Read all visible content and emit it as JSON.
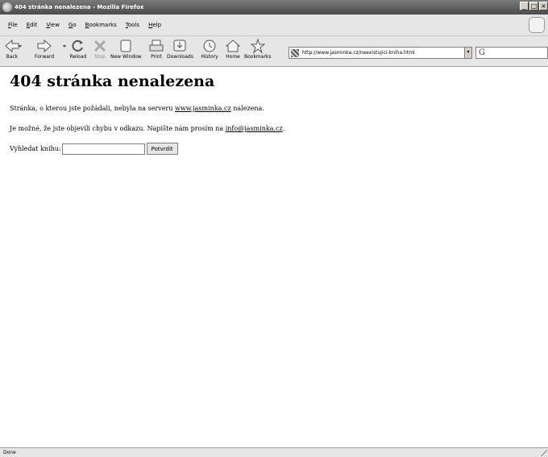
{
  "window": {
    "title": "404 stránka nenalezena - Mozilla Firefox",
    "controls": [
      "_",
      "□",
      "×"
    ]
  },
  "menu": [
    {
      "label": "File",
      "u": "F",
      "rest": "ile"
    },
    {
      "label": "Edit",
      "u": "E",
      "rest": "dit"
    },
    {
      "label": "View",
      "u": "V",
      "rest": "iew"
    },
    {
      "label": "Go",
      "u": "G",
      "rest": "o"
    },
    {
      "label": "Bookmarks",
      "u": "B",
      "rest": "ookmarks"
    },
    {
      "label": "Tools",
      "u": "T",
      "rest": "ools"
    },
    {
      "label": "Help",
      "u": "H",
      "rest": "elp"
    }
  ],
  "toolbar": {
    "back": "Back",
    "forward": "Forward",
    "reload": "Reload",
    "stop": "Stop",
    "new_window": "New Window",
    "print": "Print",
    "downloads": "Downloads",
    "history": "History",
    "home": "Home",
    "bookmarks": "Bookmarks",
    "url": "http://www.jasminka.cz/neexistujici-kniha.html",
    "url_dropdown": "▾",
    "search_engine_glyph": "G"
  },
  "page": {
    "heading": "404 stránka nenalezena",
    "p1_before": "Stránka, o kterou jste požádali, nebyla na serveru ",
    "p1_link": "www.jasminka.cz",
    "p1_after": " nalezena.",
    "p2_before": "Je možné, že jste objevili chybu v odkazu. Napište nám prosím na ",
    "p2_link": "info@jasminka.cz",
    "p2_after": ".",
    "search_label": "Vyhledat knihu:",
    "search_value": "",
    "submit_label": "Potvrdit"
  },
  "status": {
    "text": "Done"
  },
  "colors": {
    "chrome": "#e6e6e6",
    "titlebar": "#5a5a5a"
  }
}
